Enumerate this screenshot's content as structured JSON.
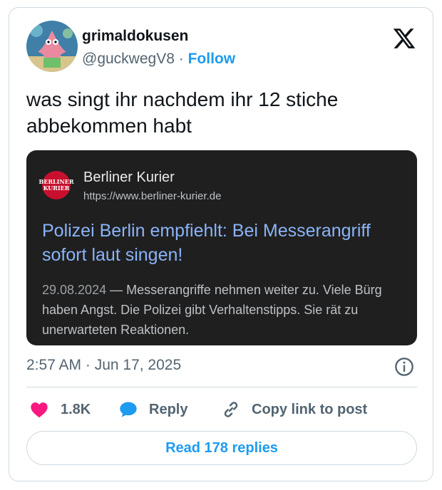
{
  "author": {
    "display_name": "grimaldokusen",
    "handle": "@guckwegV8",
    "separator": "·",
    "follow_label": "Follow"
  },
  "tweet": {
    "text_line1": "was singt ihr nachdem ihr 12 stiche",
    "text_line2": "abbekommen habt",
    "timestamp": "2:57 AM · Jun 17, 2025"
  },
  "embed": {
    "favicon_text_line1": "BERLINER",
    "favicon_text_line2": "KURIER",
    "site_name": "Berliner Kurier",
    "site_url": "https://www.berliner-kurier.de",
    "headline_line1": "Polizei Berlin empfiehlt: Bei Messerangriff",
    "headline_line2": "sofort laut singen!",
    "snippet_date": "29.08.2024",
    "snippet_line1": " — Messerangriffe nehmen weiter zu. Viele Bürg",
    "snippet_line2": "haben Angst. Die Polizei gibt Verhaltenstipps. Sie rät zu",
    "snippet_line3": "unerwarteten Reaktionen."
  },
  "actions": {
    "like_count": "1.8K",
    "reply_label": "Reply",
    "copy_link_label": "Copy link to post"
  },
  "read_replies_label": "Read 178 replies",
  "icons": {
    "logo": "x-logo-icon",
    "like": "heart-icon",
    "reply": "speech-bubble-icon",
    "copy": "link-icon",
    "info": "info-icon"
  },
  "colors": {
    "accent": "#1d9bf0",
    "like": "#f91880",
    "embed_bg": "#1f1f1f",
    "embed_link": "#8ab4f8",
    "muted": "#536471"
  }
}
